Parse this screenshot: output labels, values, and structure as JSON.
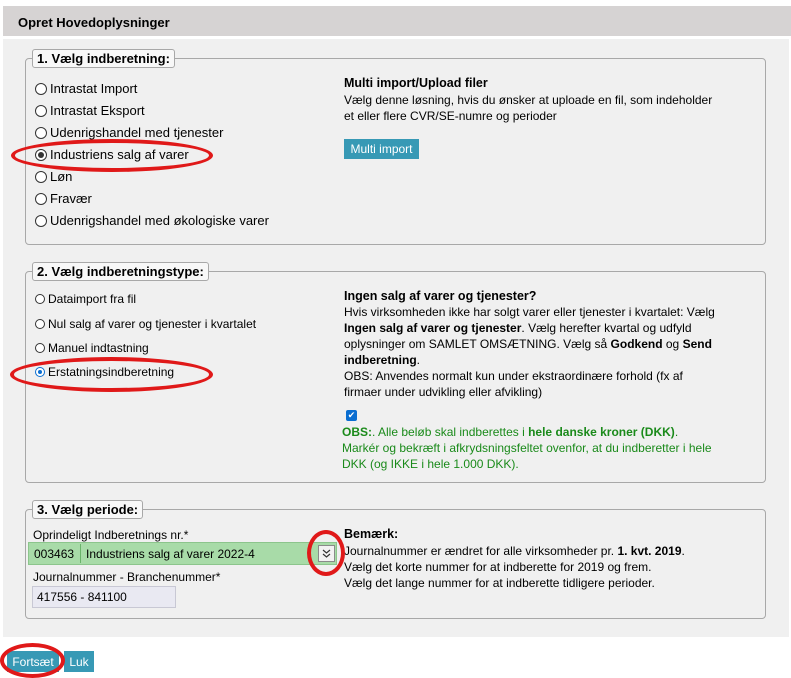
{
  "header": {
    "title": "Opret Hovedoplysninger"
  },
  "section1": {
    "legend": "1. Vælg indberetning:",
    "options": [
      {
        "label": "Intrastat Import",
        "checked": false
      },
      {
        "label": "Intrastat Eksport",
        "checked": false
      },
      {
        "label": "Udenrigshandel med tjenester",
        "checked": false
      },
      {
        "label": "Industriens salg af varer",
        "checked": true
      },
      {
        "label": "Løn",
        "checked": false
      },
      {
        "label": "Fravær",
        "checked": false
      },
      {
        "label": "Udenrigshandel med økologiske varer",
        "checked": false
      }
    ],
    "info": {
      "title": "Multi import/Upload filer",
      "line1": "Vælg denne løsning, hvis du ønsker at uploade en fil, som indeholder",
      "line2": "et eller flere CVR/SE-numre og perioder",
      "button": "Multi import"
    }
  },
  "section2": {
    "legend": "2. Vælg indberetningstype:",
    "options": [
      {
        "label": "Dataimport fra fil",
        "checked": false
      },
      {
        "label": "Nul salg af varer og tjenester i kvartalet",
        "checked": false
      },
      {
        "label": "Manuel indtastning",
        "checked": false
      },
      {
        "label": "Erstatningsindberetning",
        "checked": true
      }
    ],
    "info": {
      "title": "Ingen salg af varer og tjenester?",
      "l1": "Hvis virksomheden ikke har solgt varer eller tjenester i kvartalet: Vælg",
      "l2_bold": "Ingen salg af varer og tjenester",
      "l2_rest": ". Vælg herefter kvartal og udfyld",
      "l3_a": "oplysninger om SAMLET OMSÆTNING. Vælg så ",
      "l3_bold1": "Godkend",
      "l3_b": " og ",
      "l3_bold2": "Send",
      "l4_bold": "indberetning",
      "l4_rest": ".",
      "l5": "OBS: Anvendes normalt kun under ekstraordinære forhold (fx af",
      "l6": "firmaer under udvikling eller afvikling)"
    },
    "obs": {
      "checked": true,
      "bold1": "OBS:",
      "t1": ". Alle beløb skal indberettes i ",
      "bold2": "hele danske kroner (DKK)",
      "t1_end": ".",
      "l2": "Markér og bekræft i afkrydsningsfeltet ovenfor, at du indberetter i hele",
      "l3": "DKK (og IKKE i hele 1.000 DKK)."
    }
  },
  "section3": {
    "legend": "3. Vælg periode:",
    "orig_label": "Oprindeligt Indberetnings nr.*",
    "select_code": "003463",
    "select_desc": "Industriens salg af varer 2022-4",
    "journal_label": "Journalnummer - Branchenummer*",
    "journal_value": "417556 - 841100",
    "note": {
      "title": "Bemærk:",
      "l1_a": "Journalnummer er ændret for alle virksomheder pr. ",
      "l1_bold": "1. kvt. 2019",
      "l1_end": ".",
      "l2": "Vælg det korte nummer for at indberette for 2019 og frem.",
      "l3": "Vælg det lange nummer for at indberette tidligere perioder."
    }
  },
  "footer": {
    "continue": "Fortsæt",
    "close": "Luk"
  },
  "colors": {
    "accent": "#3799b5",
    "annotation": "#e01919",
    "selected_field": "#a8dba8",
    "obs_text": "#1a8a1a"
  },
  "icons": {
    "select_arrow": "chevron-double-down-icon"
  }
}
